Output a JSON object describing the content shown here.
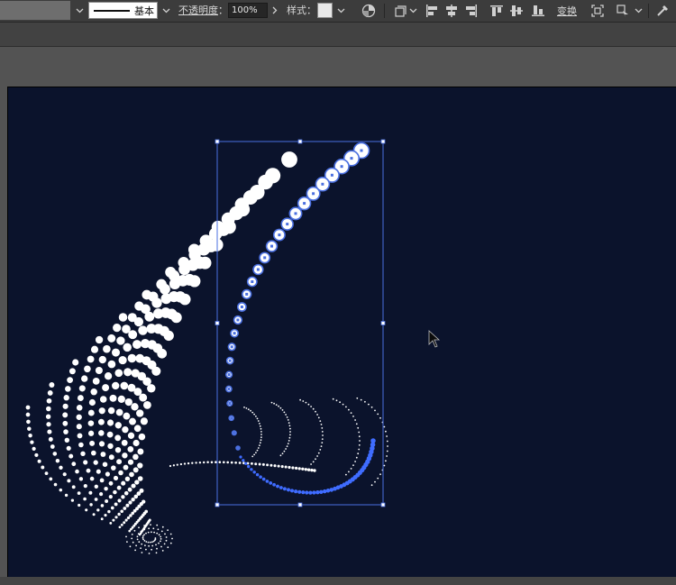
{
  "control_bar": {
    "stroke_profile": "基本",
    "opacity_label": "不透明度",
    "opacity_colon": "：",
    "opacity_value": "100%",
    "style_label": "样式：",
    "transform_label": "变换"
  },
  "icons": {
    "dropdown": "chevron-down-icon",
    "arrow": "chevron-right-icon",
    "recolor": "recolor-artwork-icon",
    "shape": "shape-select-icon",
    "align_left": "align-left-icon",
    "align_hcenter": "align-horizontal-center-icon",
    "align_right": "align-right-icon",
    "align_top": "align-top-icon",
    "align_vcenter": "align-vertical-center-icon",
    "align_bottom": "align-bottom-icon",
    "isolate": "isolate-group-icon",
    "puppet": "puppet-warp-icon",
    "wand": "edit-path-icon",
    "cursor": "cursor-arrow-icon"
  },
  "colors": {
    "artboard": "#0b132c",
    "dots": "#ffffff",
    "selection": "#4a6fe0",
    "selected_dot_fill": "#ffffff",
    "selected_tail": "#3f6cff"
  }
}
